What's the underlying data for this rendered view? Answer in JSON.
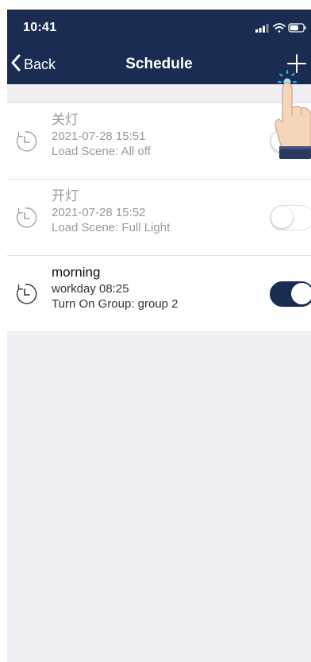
{
  "status_bar": {
    "time": "10:41",
    "icons": [
      "signal-icon",
      "wifi-icon",
      "battery-icon"
    ]
  },
  "nav": {
    "back_label": "Back",
    "title": "Schedule",
    "add_icon": "plus-icon"
  },
  "colors": {
    "header": "#1b2c52",
    "background": "#efeff4",
    "toggle_on": "#1b2c52",
    "hint_cyan": "#1fb6e8"
  },
  "schedules": [
    {
      "title": "关灯",
      "time": "2021-07-28 15:51",
      "action": "Load Scene: All off",
      "enabled": false,
      "icon": "clock-icon"
    },
    {
      "title": "开灯",
      "time": "2021-07-28 15:52",
      "action": "Load Scene: Full Light",
      "enabled": false,
      "icon": "clock-icon"
    },
    {
      "title": "morning",
      "time": "workday 08:25",
      "action": "Turn On Group: group 2",
      "enabled": true,
      "icon": "clock-icon"
    }
  ]
}
